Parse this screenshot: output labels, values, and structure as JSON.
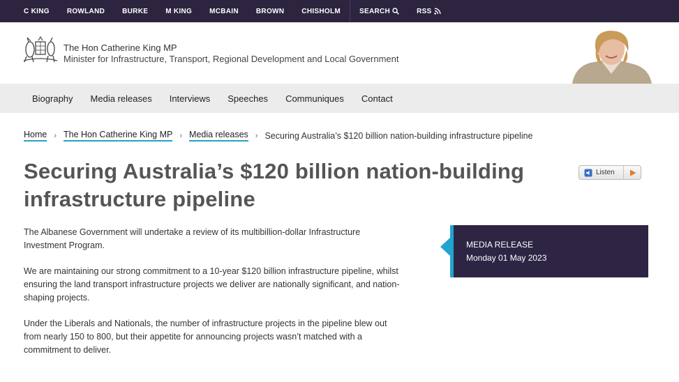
{
  "topbar": {
    "links": [
      "C KING",
      "ROWLAND",
      "BURKE",
      "M KING",
      "MCBAIN",
      "BROWN",
      "CHISHOLM"
    ],
    "search_label": "SEARCH",
    "rss_label": "RSS"
  },
  "header": {
    "minister_name": "The Hon Catherine King MP",
    "minister_title": "Minister for Infrastructure, Transport, Regional Development and Local Government"
  },
  "nav": {
    "items": [
      "Biography",
      "Media releases",
      "Interviews",
      "Speeches",
      "Communiques",
      "Contact"
    ]
  },
  "breadcrumb": {
    "home": "Home",
    "minister": "The Hon Catherine King MP",
    "section": "Media releases",
    "current": "Securing Australia’s $120 billion nation-building infrastructure pipeline"
  },
  "article": {
    "title": "Securing Australia’s $120 billion nation-building infrastructure pipeline",
    "paragraphs": [
      "The Albanese Government will undertake a review of its multibillion-dollar Infrastructure Investment Program.",
      "We are maintaining our strong commitment to a 10-year $120 billion infrastructure pipeline, whilst ensuring the land transport infrastructure projects we deliver are nationally significant, and nation-shaping projects.",
      "Under the Liberals and Nationals, the number of infrastructure projects in the pipeline blew out from nearly 150 to 800, but their appetite for announcing projects wasn’t matched with a commitment to deliver."
    ]
  },
  "listen": {
    "label": "Listen"
  },
  "release": {
    "kind": "MEDIA RELEASE",
    "date": "Monday 01 May 2023"
  },
  "colors": {
    "topbar": "#2d2440",
    "accent": "#21a4d0",
    "nav_bg": "#ececec",
    "release_bg": "#2e2545"
  }
}
